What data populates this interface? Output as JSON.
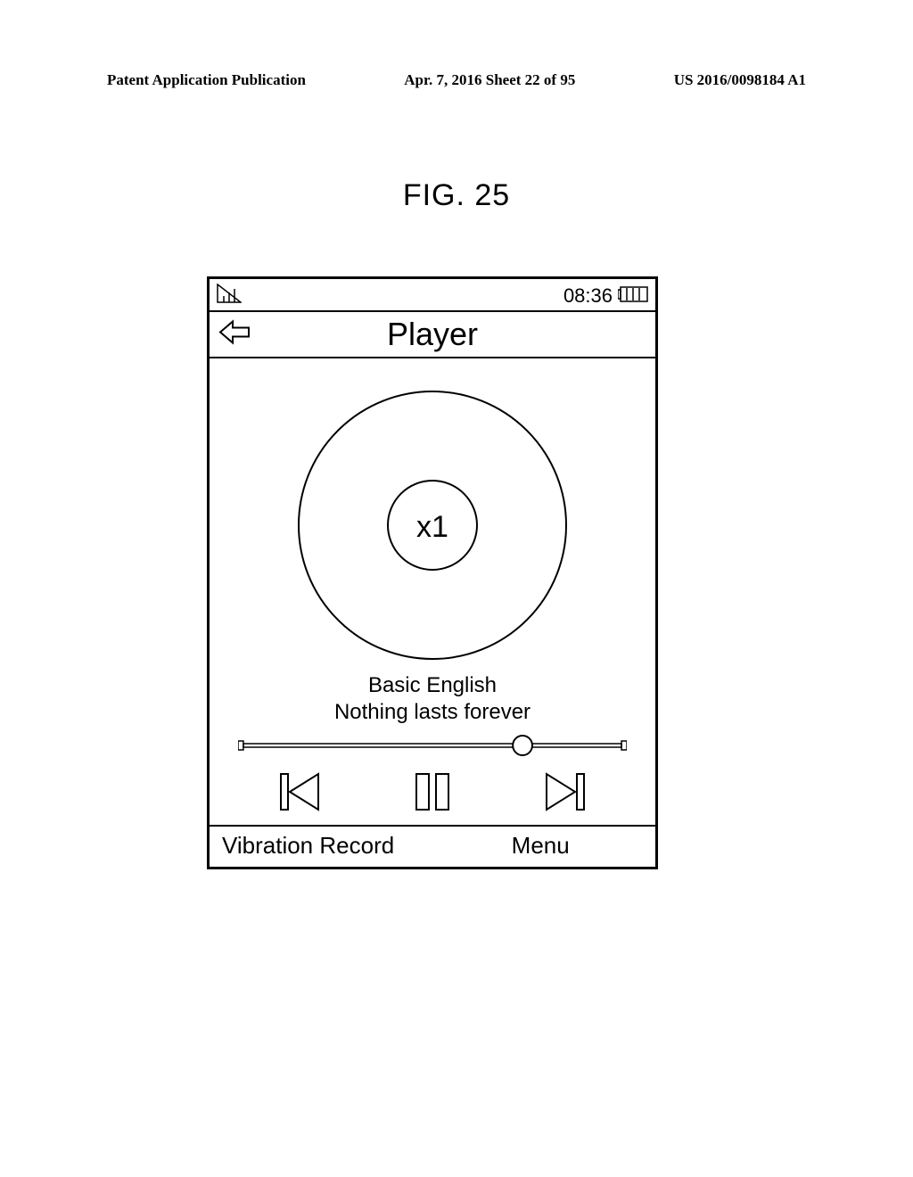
{
  "header": {
    "left": "Patent Application Publication",
    "center": "Apr. 7, 2016  Sheet 22 of 95",
    "right": "US 2016/0098184 A1"
  },
  "figure_label": "FIG. 25",
  "status": {
    "time": "08:36"
  },
  "title_bar": {
    "title": "Player"
  },
  "disc": {
    "speed_label": "x1"
  },
  "now_playing": {
    "album": "Basic English",
    "track": "Nothing lasts forever"
  },
  "progress": {
    "percent": 72
  },
  "soft_keys": {
    "left": "Vibration Record",
    "right": "Menu"
  }
}
